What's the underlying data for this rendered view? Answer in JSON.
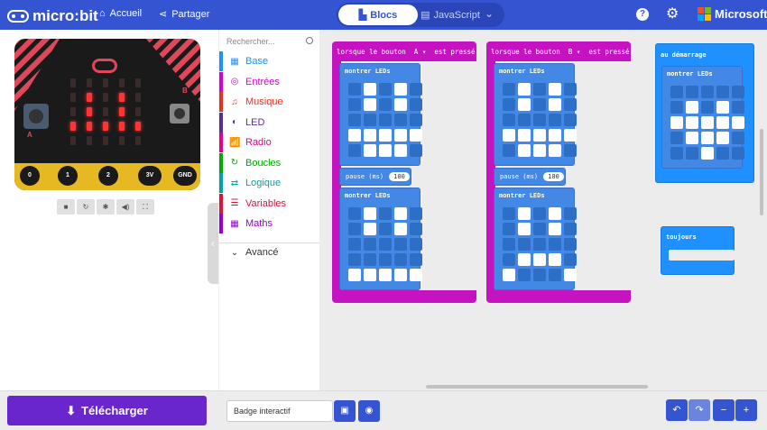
{
  "header": {
    "brand": "micro:bit",
    "home": "Accueil",
    "share": "Partager",
    "mode_blocks": "Blocs",
    "mode_js": "JavaScript",
    "ms": "Microsoft",
    "help": "?"
  },
  "toolbox": {
    "search_placeholder": "Rechercher...",
    "categories": [
      {
        "label": "Base",
        "color": "#1e90ff"
      },
      {
        "label": "Entrées",
        "color": "#d400d4"
      },
      {
        "label": "Musique",
        "color": "#e63022"
      },
      {
        "label": "LED",
        "color": "#5c2d91"
      },
      {
        "label": "Radio",
        "color": "#e3008c"
      },
      {
        "label": "Boucles",
        "color": "#00aa00"
      },
      {
        "label": "Logique",
        "color": "#00a4a6"
      },
      {
        "label": "Variables",
        "color": "#dc143c"
      },
      {
        "label": "Maths",
        "color": "#9400d3"
      },
      {
        "label": "Avancé",
        "color": "#3c3c3c"
      }
    ]
  },
  "sim": {
    "pins": [
      "0",
      "1",
      "2",
      "3V",
      "GND"
    ],
    "btn_a": "A",
    "btn_b": "B",
    "led_on": [
      [
        1,
        1
      ],
      [
        1,
        3
      ],
      [
        2,
        1
      ],
      [
        2,
        3
      ],
      [
        3,
        0
      ],
      [
        3,
        1
      ],
      [
        3,
        2
      ],
      [
        3,
        3
      ],
      [
        3,
        4
      ]
    ]
  },
  "blocks": {
    "evt_a": {
      "label": "lorsque le bouton  A ▾  est pressé"
    },
    "evt_b": {
      "label": "lorsque le bouton  B ▾  est pressé"
    },
    "start": {
      "label": "au démarrage"
    },
    "forever": {
      "label": "toujours"
    },
    "show_leds": "montrer LEDs",
    "pause_label": "pause (ms)",
    "pause_value": "100",
    "grids": {
      "a1": [
        [
          0,
          1,
          0,
          1,
          0
        ],
        [
          0,
          1,
          0,
          1,
          0
        ],
        [
          0,
          0,
          0,
          0,
          0
        ],
        [
          1,
          1,
          1,
          1,
          1
        ],
        [
          0,
          1,
          1,
          1,
          0
        ]
      ],
      "a2": [
        [
          0,
          1,
          0,
          1,
          0
        ],
        [
          0,
          1,
          0,
          1,
          0
        ],
        [
          0,
          0,
          0,
          0,
          0
        ],
        [
          0,
          0,
          0,
          0,
          0
        ],
        [
          1,
          1,
          1,
          1,
          1
        ]
      ],
      "b1": [
        [
          0,
          1,
          0,
          1,
          0
        ],
        [
          0,
          1,
          0,
          1,
          0
        ],
        [
          0,
          0,
          0,
          0,
          0
        ],
        [
          1,
          1,
          1,
          1,
          1
        ],
        [
          0,
          1,
          1,
          1,
          0
        ]
      ],
      "b2": [
        [
          0,
          1,
          0,
          1,
          0
        ],
        [
          0,
          1,
          0,
          1,
          0
        ],
        [
          0,
          0,
          0,
          0,
          0
        ],
        [
          0,
          1,
          1,
          1,
          0
        ],
        [
          1,
          0,
          0,
          0,
          1
        ]
      ],
      "s1": [
        [
          0,
          0,
          0,
          0,
          0
        ],
        [
          0,
          1,
          0,
          1,
          0
        ],
        [
          1,
          1,
          1,
          1,
          1
        ],
        [
          0,
          1,
          1,
          1,
          0
        ],
        [
          0,
          0,
          1,
          0,
          0
        ]
      ]
    }
  },
  "bottom": {
    "download": "Télécharger",
    "project_name": "Badge interactif"
  }
}
